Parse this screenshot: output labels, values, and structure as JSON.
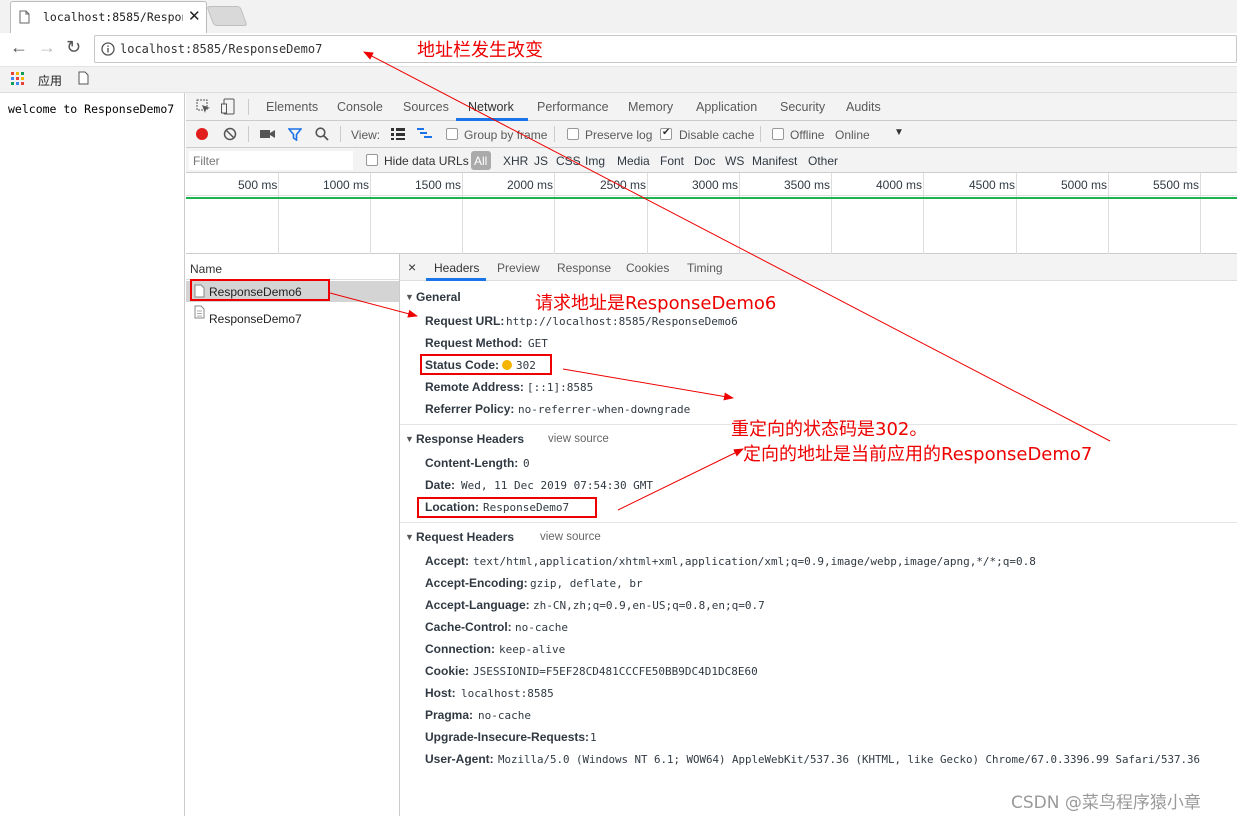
{
  "browser": {
    "tab_title": "localhost:8585/Respons",
    "address": "localhost:8585/ResponseDemo7",
    "bookmarks_apps_label": "应用"
  },
  "page": {
    "body_text": "welcome to ResponseDemo7"
  },
  "devtools": {
    "tabs": [
      "Elements",
      "Console",
      "Sources",
      "Network",
      "Performance",
      "Memory",
      "Application",
      "Security",
      "Audits"
    ],
    "active_tab": "Network",
    "toolbar": {
      "view_label": "View:",
      "group_by_frame": "Group by frame",
      "preserve_log": "Preserve log",
      "disable_cache": "Disable cache",
      "offline": "Offline",
      "online": "Online"
    },
    "filter": {
      "placeholder": "Filter",
      "hide_data_urls": "Hide data URLs",
      "types": [
        "All",
        "XHR",
        "JS",
        "CSS",
        "Img",
        "Media",
        "Font",
        "Doc",
        "WS",
        "Manifest",
        "Other"
      ]
    },
    "timeline_ticks": [
      "500 ms",
      "1000 ms",
      "1500 ms",
      "2000 ms",
      "2500 ms",
      "3000 ms",
      "3500 ms",
      "4000 ms",
      "4500 ms",
      "5000 ms",
      "5500 ms"
    ],
    "name_header": "Name",
    "requests": [
      "ResponseDemo6",
      "ResponseDemo7"
    ],
    "detail_tabs": [
      "Headers",
      "Preview",
      "Response",
      "Cookies",
      "Timing"
    ],
    "close_symbol": "×",
    "general": {
      "title": "General",
      "rows": [
        {
          "key": "Request URL:",
          "value": "http://localhost:8585/ResponseDemo6"
        },
        {
          "key": "Request Method:",
          "value": "GET"
        },
        {
          "key": "Status Code:",
          "value": "302"
        },
        {
          "key": "Remote Address:",
          "value": "[::1]:8585"
        },
        {
          "key": "Referrer Policy:",
          "value": "no-referrer-when-downgrade"
        }
      ]
    },
    "response_headers": {
      "title": "Response Headers",
      "view_source": "view source",
      "rows": [
        {
          "key": "Content-Length:",
          "value": "0"
        },
        {
          "key": "Date:",
          "value": "Wed, 11 Dec 2019 07:54:30 GMT"
        },
        {
          "key": "Location:",
          "value": "ResponseDemo7"
        }
      ]
    },
    "request_headers": {
      "title": "Request Headers",
      "view_source": "view source",
      "rows": [
        {
          "key": "Accept:",
          "value": "text/html,application/xhtml+xml,application/xml;q=0.9,image/webp,image/apng,*/*;q=0.8"
        },
        {
          "key": "Accept-Encoding:",
          "value": "gzip, deflate, br"
        },
        {
          "key": "Accept-Language:",
          "value": "zh-CN,zh;q=0.9,en-US;q=0.8,en;q=0.7"
        },
        {
          "key": "Cache-Control:",
          "value": "no-cache"
        },
        {
          "key": "Connection:",
          "value": "keep-alive"
        },
        {
          "key": "Cookie:",
          "value": "JSESSIONID=F5EF28CD481CCCFE50BB9DC4D1DC8E60"
        },
        {
          "key": "Host:",
          "value": "localhost:8585"
        },
        {
          "key": "Pragma:",
          "value": "no-cache"
        },
        {
          "key": "Upgrade-Insecure-Requests:",
          "value": "1"
        },
        {
          "key": "User-Agent:",
          "value": "Mozilla/5.0 (Windows NT 6.1; WOW64) AppleWebKit/537.36 (KHTML, like Gecko) Chrome/67.0.3396.99 Safari/537.36"
        }
      ]
    }
  },
  "annotations": {
    "address_changed": "地址栏发生改变",
    "request_url_note": "请求地址是ResponseDemo6",
    "status_note": "重定向的状态码是302。",
    "location_note": "定向的地址是当前应用的ResponseDemo7"
  },
  "watermark": "CSDN @菜鸟程序猿小章",
  "colors": {
    "annotation_red": "#e00000",
    "network_active": "#1a73e8",
    "timeline_green": "#1db34f",
    "status_dot": "#f5b400"
  }
}
